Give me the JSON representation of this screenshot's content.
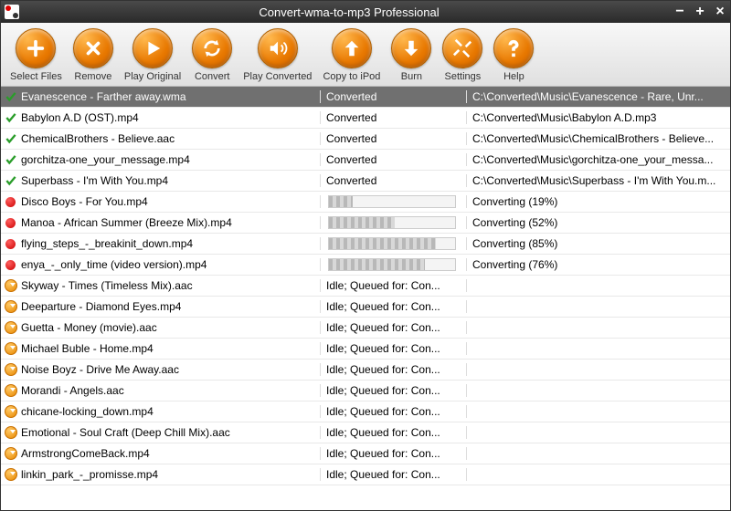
{
  "window": {
    "title": "Convert-wma-to-mp3 Professional"
  },
  "toolbar": [
    {
      "label": "Select Files",
      "icon": "plus"
    },
    {
      "label": "Remove",
      "icon": "x"
    },
    {
      "label": "Play Original",
      "icon": "play"
    },
    {
      "label": "Convert",
      "icon": "refresh"
    },
    {
      "label": "Play Converted",
      "icon": "sound"
    },
    {
      "label": "Copy to iPod",
      "icon": "up"
    },
    {
      "label": "Burn",
      "icon": "down"
    },
    {
      "label": "Settings",
      "icon": "tools"
    },
    {
      "label": "Help",
      "icon": "question"
    }
  ],
  "rows": [
    {
      "status": "done",
      "selected": true,
      "name": "Evanescence - Farther away.wma",
      "col2type": "text",
      "col2": "Converted",
      "col3": "C:\\Converted\\Music\\Evanescence - Rare, Unr..."
    },
    {
      "status": "done",
      "name": "Babylon A.D (OST).mp4",
      "col2type": "text",
      "col2": "Converted",
      "col3": "C:\\Converted\\Music\\Babylon A.D.mp3"
    },
    {
      "status": "done",
      "name": "ChemicalBrothers - Believe.aac",
      "col2type": "text",
      "col2": "Converted",
      "col3": "C:\\Converted\\Music\\ChemicalBrothers - Believe..."
    },
    {
      "status": "done",
      "name": "gorchitza-one_your_message.mp4",
      "col2type": "text",
      "col2": "Converted",
      "col3": "C:\\Converted\\Music\\gorchitza-one_your_messa..."
    },
    {
      "status": "done",
      "name": "Superbass - I'm With You.mp4",
      "col2type": "text",
      "col2": "Converted",
      "col3": "C:\\Converted\\Music\\Superbass - I'm With You.m..."
    },
    {
      "status": "converting",
      "name": "Disco Boys - For You.mp4",
      "col2type": "progress",
      "progress": 19,
      "col3": "Converting (19%)"
    },
    {
      "status": "converting",
      "name": "Manoa - African Summer (Breeze Mix).mp4",
      "col2type": "progress",
      "progress": 52,
      "col3": "Converting (52%)"
    },
    {
      "status": "converting",
      "name": "flying_steps_-_breakinit_down.mp4",
      "col2type": "progress",
      "progress": 85,
      "col3": "Converting (85%)"
    },
    {
      "status": "converting",
      "name": "enya_-_only_time (video version).mp4",
      "col2type": "progress",
      "progress": 76,
      "col3": "Converting (76%)"
    },
    {
      "status": "queued",
      "name": "Skyway - Times (Timeless Mix).aac",
      "col2type": "text",
      "col2": "Idle; Queued for: Con...",
      "col3": ""
    },
    {
      "status": "queued",
      "name": "Deeparture - Diamond Eyes.mp4",
      "col2type": "text",
      "col2": "Idle; Queued for: Con...",
      "col3": ""
    },
    {
      "status": "queued",
      "name": "Guetta - Money (movie).aac",
      "col2type": "text",
      "col2": "Idle; Queued for: Con...",
      "col3": ""
    },
    {
      "status": "queued",
      "name": "Michael Buble - Home.mp4",
      "col2type": "text",
      "col2": "Idle; Queued for: Con...",
      "col3": ""
    },
    {
      "status": "queued",
      "name": "Noise Boyz - Drive Me Away.aac",
      "col2type": "text",
      "col2": "Idle; Queued for: Con...",
      "col3": ""
    },
    {
      "status": "queued",
      "name": "Morandi - Angels.aac",
      "col2type": "text",
      "col2": "Idle; Queued for: Con...",
      "col3": ""
    },
    {
      "status": "queued",
      "name": "chicane-locking_down.mp4",
      "col2type": "text",
      "col2": "Idle; Queued for: Con...",
      "col3": ""
    },
    {
      "status": "queued",
      "name": "Emotional - Soul Craft (Deep Chill Mix).aac",
      "col2type": "text",
      "col2": "Idle; Queued for: Con...",
      "col3": ""
    },
    {
      "status": "queued",
      "name": "ArmstrongComeBack.mp4",
      "col2type": "text",
      "col2": "Idle; Queued for: Con...",
      "col3": ""
    },
    {
      "status": "queued",
      "name": "linkin_park_-_promisse.mp4",
      "col2type": "text",
      "col2": "Idle; Queued for: Con...",
      "col3": ""
    }
  ]
}
